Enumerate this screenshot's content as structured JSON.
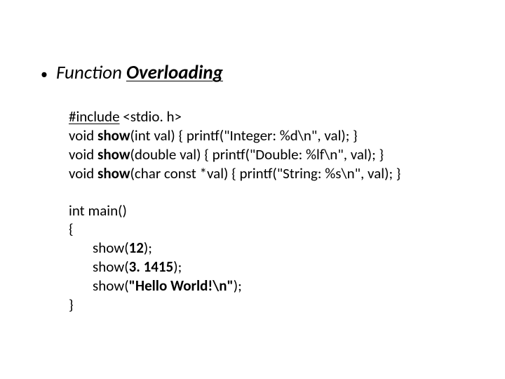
{
  "heading": {
    "function_word": "Function",
    "overloading_word": "Overloading"
  },
  "code": {
    "l1_include": "#include",
    "l1_rest": " <stdio. h>",
    "l2_void": "void ",
    "l2_show": "show",
    "l2_rest": "(int val) { printf(\"Integer: %d\\n\", val); }",
    "l3_void": "void ",
    "l3_show": "show",
    "l3_rest": "(double val) { printf(\"Double: %lf\\n\", val); }",
    "l4_void": "void ",
    "l4_show": "show",
    "l4_rest": "(char const *val) { printf(\"String: %s\\n\", val); }",
    "main_sig": "int main()",
    "brace_open": "{",
    "call1_pre": "show(",
    "call1_arg": "12",
    "call1_post": ");",
    "call2_pre": "show(",
    "call2_arg": "3. 1415",
    "call2_post": ");",
    "call3_pre": "show(",
    "call3_arg": "\"Hello World!\\n\"",
    "call3_post": ");",
    "brace_close": "}"
  }
}
